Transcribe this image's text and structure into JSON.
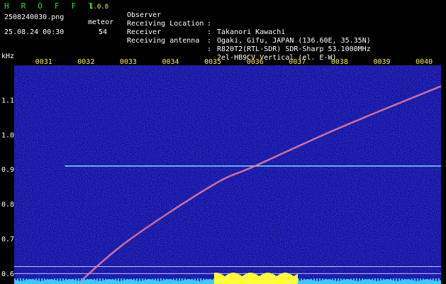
{
  "header": {
    "title": "H R O F F T",
    "version": "1.0.0",
    "filename": "2508240030.png",
    "meteor_label": "meteor",
    "datetime": "25.08.24 00:30",
    "meteor_count": "54"
  },
  "info": [
    {
      "label": "Observer",
      "value": "Takanori Kawachi"
    },
    {
      "label": "Receiving Location",
      "value": "Ogaki, Gifu, JAPAN (136.60E, 35.35N)"
    },
    {
      "label": "Receiver",
      "value": "R820T2(RTL-SDR) SDR-Sharp 53.1000MHz"
    },
    {
      "label": "Receiving antenna",
      "value": "2el-HB9CV Vertical (el. E-W)"
    }
  ],
  "colors": {
    "tick_label": "#f6f04a",
    "header_text": "#ffffff",
    "title": "#29e03a",
    "trace": "#ff3355",
    "carrier": "#7ff0ff",
    "noise_base": "#10108c",
    "bottom_level_low": "#3cc8ff",
    "bottom_level_high": "#ffff3a"
  },
  "chart_data": {
    "type": "heatmap",
    "ylabel": "kHz",
    "x_ticks": [
      "0031",
      "0032",
      "0033",
      "0034",
      "0035",
      "0036",
      "0037",
      "0038",
      "0039",
      "0040"
    ],
    "y_ticks": [
      "1.1",
      "1.0",
      "0.9",
      "0.8",
      "0.7",
      "0.6"
    ],
    "ylim": [
      0.57,
      1.2
    ],
    "xlim": [
      0.3,
      10.4
    ],
    "carrier_khz": 0.91,
    "carrier_x_range": [
      1.5,
      10.4
    ],
    "meteor_trace": {
      "points": [
        {
          "x": 1.8,
          "y": 0.57
        },
        {
          "x": 3.0,
          "y": 0.695
        },
        {
          "x": 5.0,
          "y": 0.855
        },
        {
          "x": 6.0,
          "y": 0.91
        },
        {
          "x": 8.0,
          "y": 1.02
        },
        {
          "x": 10.4,
          "y": 1.14
        }
      ]
    }
  }
}
